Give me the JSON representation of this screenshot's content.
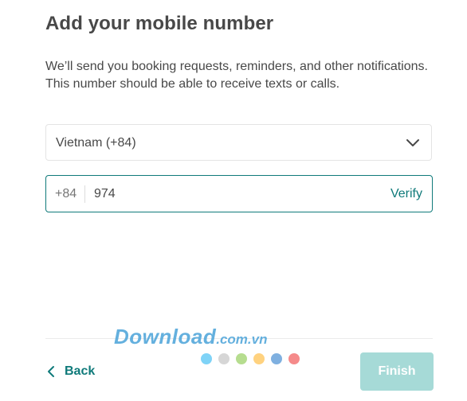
{
  "title": "Add your mobile number",
  "description": "We’ll send you booking requests, reminders, and other notifications. This number should be able to receive texts or calls.",
  "country_select": {
    "value": "Vietnam (+84)",
    "icon": "chevron-down-icon"
  },
  "phone": {
    "prefix": "+84",
    "value": "974",
    "verify_label": "Verify"
  },
  "footer": {
    "back_label": "Back",
    "finish_label": "Finish"
  },
  "watermark": {
    "main": "Download",
    "tld": ".com.vn",
    "dot_colors": [
      "#7fd3f7",
      "#d6d6d6",
      "#b6dd8f",
      "#ffd27f",
      "#7fb0e0",
      "#f58a8a"
    ]
  },
  "colors": {
    "accent": "#0f7a7a",
    "finish_disabled": "#a6dad7",
    "text": "#484848"
  }
}
